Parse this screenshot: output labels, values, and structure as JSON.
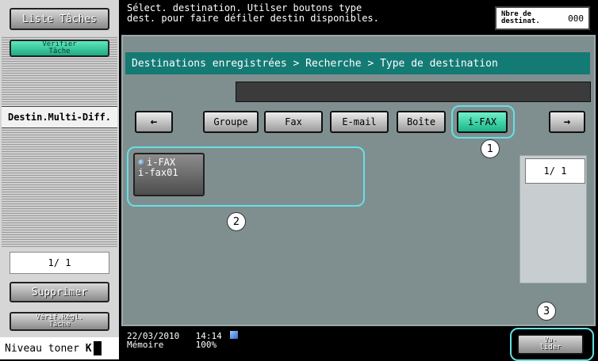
{
  "sidebar": {
    "job_list_label": "Liste Tâches",
    "verify_job_label": "Vérifier\nTâche",
    "multi_dest_label": "Destin.Multi-Diff.",
    "page_indicator": "1/  1",
    "delete_label": "Supprimer",
    "verify_settings_label": "Vérif.Régl.\nTâche",
    "toner_label": "Niveau toner",
    "toner_mark": "K"
  },
  "header": {
    "message": "Sélect. destination. Utilser boutons type\ndest. pour faire défiler destin disponibles.",
    "count_label": "Nbre de\ndestinat.",
    "count_value": "000"
  },
  "main": {
    "breadcrumb": "Destinations enregistrées > Recherche > Type de destination",
    "type_buttons": [
      {
        "label": "Groupe"
      },
      {
        "label": "Fax"
      },
      {
        "label": "E-mail"
      },
      {
        "label": "Boîte"
      },
      {
        "label": "i-FAX"
      }
    ],
    "destinations": [
      {
        "type": "i-FAX",
        "name": "i-fax01"
      }
    ],
    "page_indicator": "1/  1"
  },
  "callouts": [
    "1",
    "2",
    "3"
  ],
  "status": {
    "date": "22/03/2010",
    "time": "14:14",
    "memory_label": "Mémoire",
    "memory_value": "100%"
  },
  "validate_label": "Va-\nlider",
  "colors": {
    "accent_teal": "#147a74",
    "active_green": "#1eb489",
    "highlight": "#66e0e6"
  }
}
